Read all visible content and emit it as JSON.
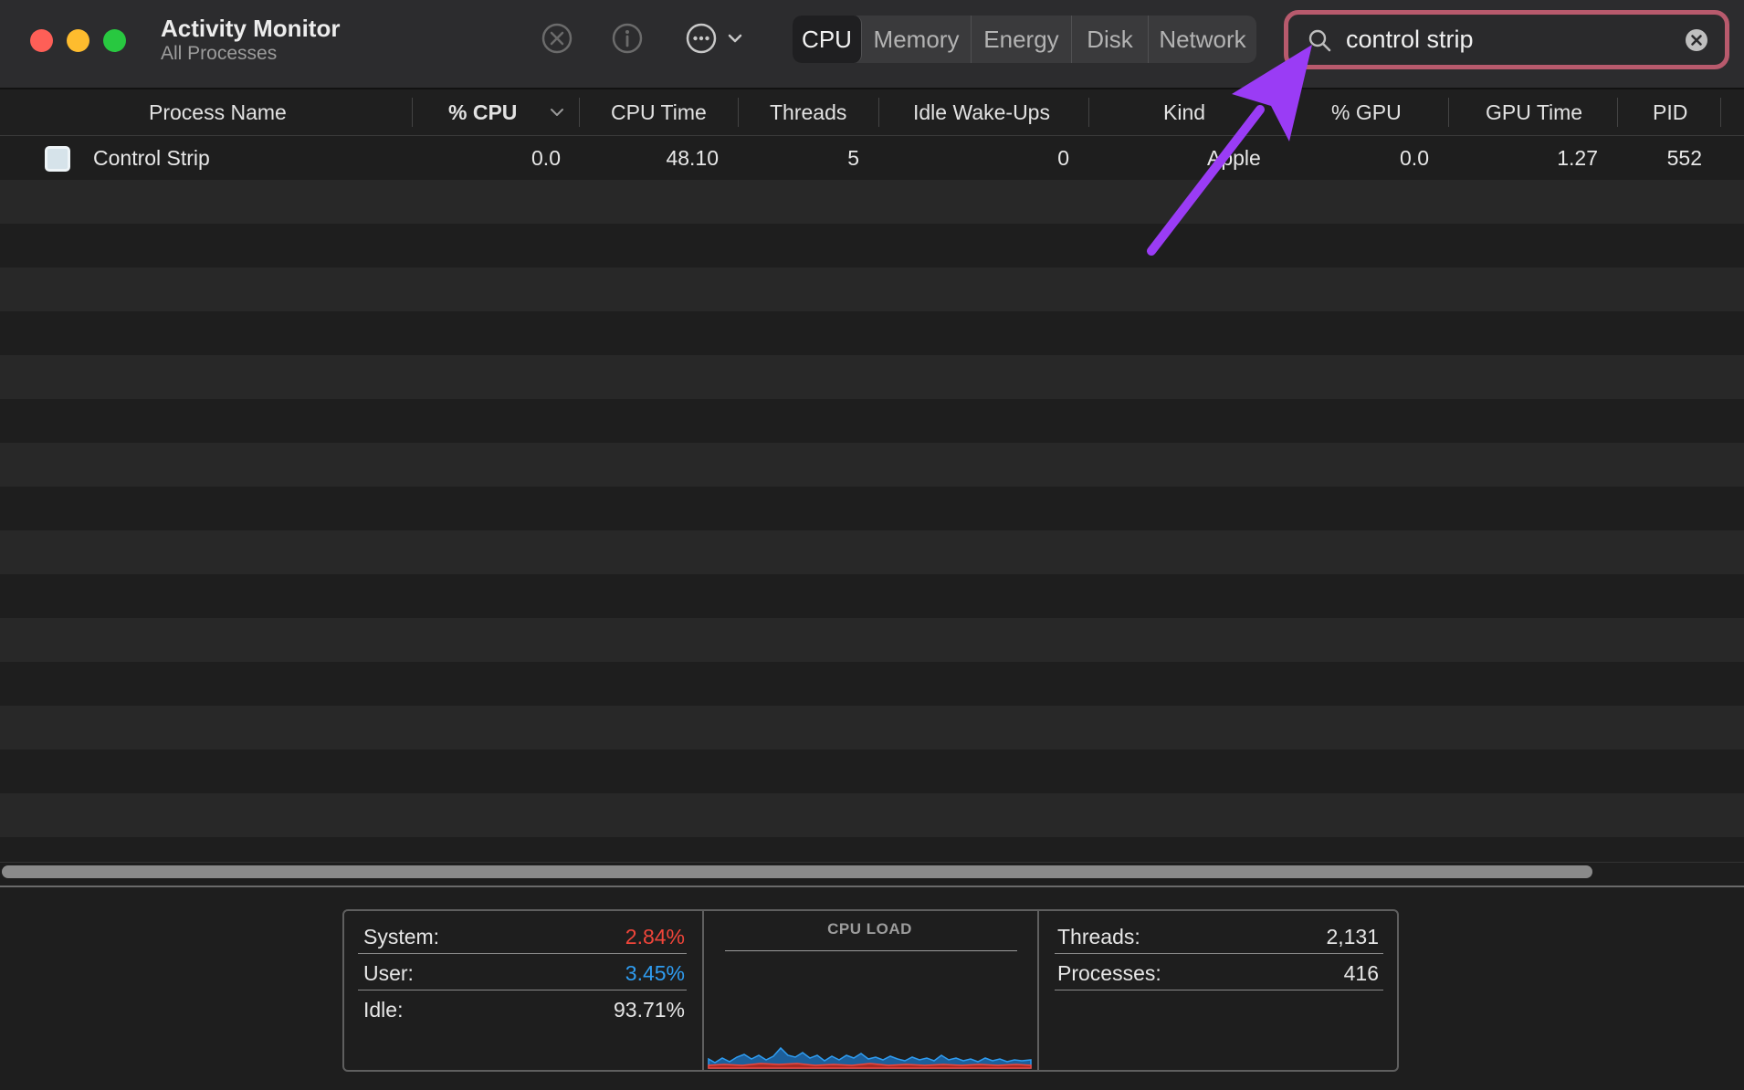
{
  "window": {
    "title": "Activity Monitor",
    "subtitle": "All Processes",
    "traffic_lights": {
      "close": "#fe5f57",
      "minimize": "#febc2e",
      "zoom": "#28c840"
    }
  },
  "toolbar": {
    "stop_icon": "stop-process-icon",
    "info_icon": "info-icon",
    "more_icon": "ellipsis-icon",
    "tabs": [
      {
        "label": "CPU",
        "active": true
      },
      {
        "label": "Memory",
        "active": false
      },
      {
        "label": "Energy",
        "active": false
      },
      {
        "label": "Disk",
        "active": false
      },
      {
        "label": "Network",
        "active": false
      }
    ]
  },
  "search": {
    "value": "control strip",
    "highlight_color": "#b85a6d"
  },
  "table": {
    "columns": [
      "Process Name",
      "% CPU",
      "CPU Time",
      "Threads",
      "Idle Wake-Ups",
      "Kind",
      "% GPU",
      "GPU Time",
      "PID"
    ],
    "sort_column": "% CPU",
    "rows": [
      {
        "process_name": "Control Strip",
        "cpu_percent": "0.0",
        "cpu_time": "48.10",
        "threads": "5",
        "idle_wakeups": "0",
        "kind": "Apple",
        "gpu_percent": "0.0",
        "gpu_time": "1.27",
        "pid": "552"
      }
    ]
  },
  "summary": {
    "system_label": "System:",
    "system_value": "2.84%",
    "system_color": "#f0453a",
    "user_label": "User:",
    "user_value": "3.45%",
    "user_color": "#2f9cf0",
    "idle_label": "Idle:",
    "idle_value": "93.71%",
    "chart_title": "CPU LOAD",
    "threads_label": "Threads:",
    "threads_value": "2,131",
    "processes_label": "Processes:",
    "processes_value": "416"
  },
  "annotation": {
    "arrow_color": "#9a3cf5"
  }
}
